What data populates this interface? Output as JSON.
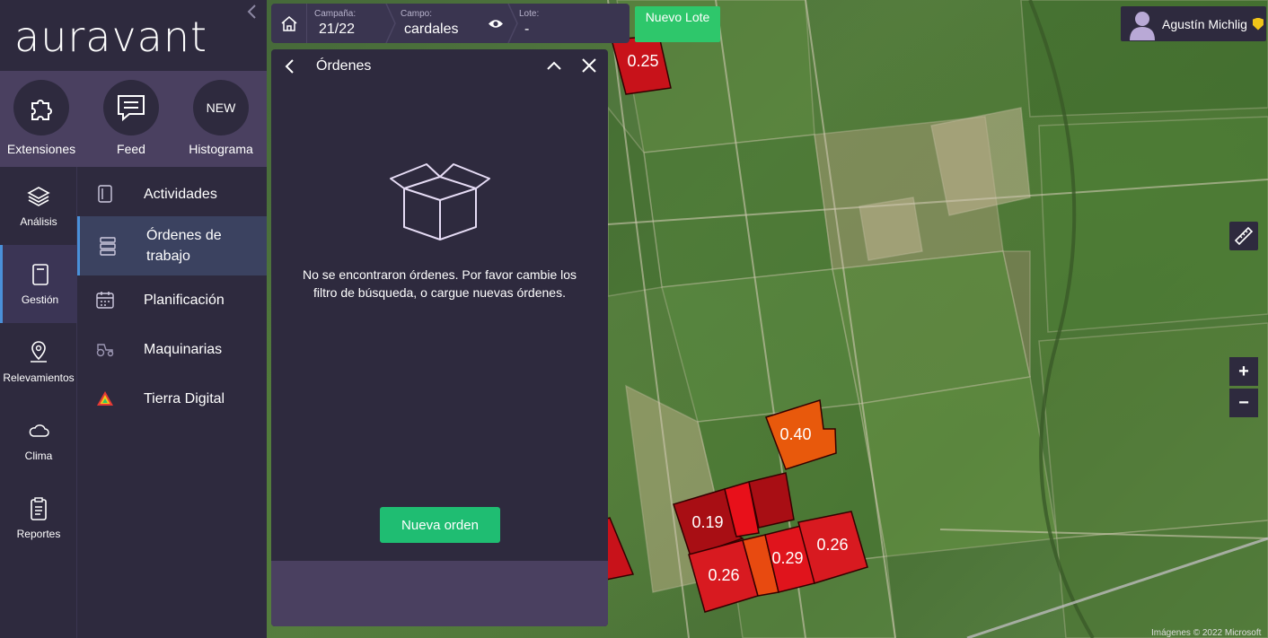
{
  "app": {
    "logo_text": "auravant"
  },
  "quick_actions": [
    {
      "label": "Extensiones",
      "icon": "puzzle-icon"
    },
    {
      "label": "Feed",
      "icon": "chat-icon"
    },
    {
      "label": "Histograma",
      "icon": "new-badge",
      "badge": "NEW"
    }
  ],
  "rail": [
    {
      "label": "Análisis",
      "icon": "layers-icon"
    },
    {
      "label": "Gestión",
      "icon": "notebook-icon",
      "active": true
    },
    {
      "label": "Relevamientos",
      "icon": "map-pin-icon"
    },
    {
      "label": "Clima",
      "icon": "cloud-icon"
    },
    {
      "label": "Reportes",
      "icon": "clipboard-icon"
    }
  ],
  "submenu": [
    {
      "label": "Actividades",
      "icon": "notebook-icon"
    },
    {
      "label": "Órdenes de trabajo",
      "icon": "server-list-icon",
      "active": true
    },
    {
      "label": "Planificación",
      "icon": "calendar-icon"
    },
    {
      "label": "Maquinarias",
      "icon": "tractor-icon"
    },
    {
      "label": "Tierra Digital",
      "icon": "warning-triangle-icon"
    }
  ],
  "topbar": {
    "campana_label": "Campaña:",
    "campana_value": "21/22",
    "campo_label": "Campo:",
    "campo_value": "cardales",
    "lote_label": "Lote:",
    "lote_value": "-",
    "new_lot_button": "Nuevo Lote"
  },
  "user": {
    "name": "Agustín Michlig"
  },
  "panel": {
    "title": "Órdenes",
    "empty_message": "No se encontraron órdenes. Por favor cambie los filtro de búsqueda, o cargue nuevas órdenes.",
    "new_order_button": "Nueva orden"
  },
  "map": {
    "lots": [
      {
        "label": "0.25",
        "color": "#c8121a"
      },
      {
        "label": "0.40",
        "color": "#e8590c"
      },
      {
        "label": "0.19",
        "color": "#a80e14"
      },
      {
        "label": "0.26",
        "color": "#d81a20"
      },
      {
        "label": "0.29",
        "color": "#e0141c"
      },
      {
        "label": "0.26",
        "color": "#d81a20"
      }
    ],
    "zoom_in": "+",
    "zoom_out": "−",
    "attribution": "Imágenes © 2022 Microsoft"
  },
  "colors": {
    "accent": "#4a90d9",
    "primary_green": "#1fbd72",
    "sidebar": "#2e2a3e"
  }
}
